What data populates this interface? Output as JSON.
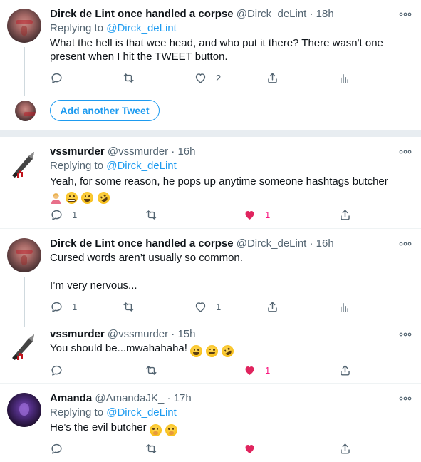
{
  "tweets": [
    {
      "name": "Dirck de Lint once handled a corpse",
      "handle": "@Dirck_deLint · 18h",
      "replying_prefix": "Replying to ",
      "replying_to": "@Dirck_deLint",
      "text_line1": "What the hell is that wee head, and who put it there? There wasn't one",
      "text_line2": "present when I hit the TWEET button.",
      "reply_count": "",
      "retweet_count": "",
      "like_count": "2"
    },
    {
      "name": "vssmurder",
      "handle": "@vssmurder · 16h",
      "replying_prefix": "Replying to ",
      "replying_to": "@Dirck_deLint",
      "text_line1": "Yeah, for some reason, he pops up anytime someone hashtags butcher",
      "emojis": [
        "woman-shrugging",
        "grimacing-face",
        "grinning-sweat",
        "rolling-on-floor-laughing"
      ],
      "reply_count": "1",
      "retweet_count": "",
      "like_count": "1"
    },
    {
      "name": "Dirck de Lint once handled a corpse",
      "handle": "@Dirck_deLint · 16h",
      "text_line1": "Cursed words aren’t usually so common.",
      "text_line2": "I’m very nervous...",
      "reply_count": "1",
      "retweet_count": "",
      "like_count": "1"
    },
    {
      "name": "vssmurder",
      "handle": "@vssmurder · 15h",
      "text_line1": "You should be...mwahahaha!",
      "emojis": [
        "grinning-face",
        "winking-face",
        "rolling-on-floor-laughing"
      ],
      "reply_count": "",
      "retweet_count": "",
      "like_count": "1"
    },
    {
      "name": "Amanda",
      "handle": "@AmandaJK_ · 17h",
      "replying_prefix": "Replying to ",
      "replying_to": "@Dirck_deLint",
      "text_line1": "He’s the evil butcher",
      "emojis": [
        "hand-over-mouth",
        "hand-over-mouth"
      ],
      "reply_count": "",
      "retweet_count": "",
      "like_count": ""
    }
  ],
  "add_tweet_label": "Add another Tweet",
  "colors": {
    "accent": "#1d9bf0",
    "like_red": "#f91880",
    "secondary_text": "#536471",
    "divider": "#e8edf1"
  }
}
